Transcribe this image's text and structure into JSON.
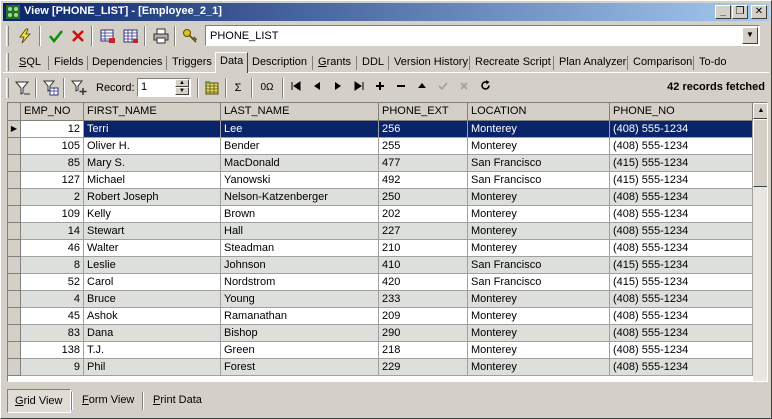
{
  "window": {
    "title": "View [PHONE_LIST] - [Employee_2_1]",
    "minimize_glyph": "_",
    "restore_glyph": "❐",
    "close_glyph": "✕"
  },
  "toolbar": {
    "object_combo_value": "PHONE_LIST",
    "icons": [
      "lightning-icon",
      "commit-check-icon",
      "rollback-x-icon",
      "grid-red-icon",
      "grid-table-icon",
      "printer-icon",
      "key-tools-icon"
    ]
  },
  "tabs": [
    {
      "label": "SQL",
      "accel": "S",
      "rest": "QL"
    },
    {
      "label": "Fields"
    },
    {
      "label": "Dependencies"
    },
    {
      "label": "Triggers"
    },
    {
      "label": "Data"
    },
    {
      "label": "Description"
    },
    {
      "label": "Grants",
      "accel": "G",
      "rest": "rants"
    },
    {
      "label": "DDL"
    },
    {
      "label": "Version History"
    },
    {
      "label": "Recreate Script"
    },
    {
      "label": "Plan Analyzer"
    },
    {
      "label": "Comparison"
    },
    {
      "label": "To-do"
    }
  ],
  "data_toolbar": {
    "record_label": "Record:",
    "record_value": "1",
    "sigma": "Σ",
    "omega": "0Ω",
    "status": "42 records fetched"
  },
  "grid": {
    "columns": [
      "EMP_NO",
      "FIRST_NAME",
      "LAST_NAME",
      "PHONE_EXT",
      "LOCATION",
      "PHONE_NO"
    ],
    "selected_row_indicator": "▶",
    "rows": [
      [
        "12",
        "Terri",
        "Lee",
        "256",
        "Monterey",
        "(408) 555-1234"
      ],
      [
        "105",
        "Oliver H.",
        "Bender",
        "255",
        "Monterey",
        "(408) 555-1234"
      ],
      [
        "85",
        "Mary S.",
        "MacDonald",
        "477",
        "San Francisco",
        "(415) 555-1234"
      ],
      [
        "127",
        "Michael",
        "Yanowski",
        "492",
        "San Francisco",
        "(415) 555-1234"
      ],
      [
        "2",
        "Robert Joseph",
        "Nelson-Katzenberger",
        "250",
        "Monterey",
        "(408) 555-1234"
      ],
      [
        "109",
        "Kelly",
        "Brown",
        "202",
        "Monterey",
        "(408) 555-1234"
      ],
      [
        "14",
        "Stewart",
        "Hall",
        "227",
        "Monterey",
        "(408) 555-1234"
      ],
      [
        "46",
        "Walter",
        "Steadman",
        "210",
        "Monterey",
        "(408) 555-1234"
      ],
      [
        "8",
        "Leslie",
        "Johnson",
        "410",
        "San Francisco",
        "(415) 555-1234"
      ],
      [
        "52",
        "Carol",
        "Nordstrom",
        "420",
        "San Francisco",
        "(415) 555-1234"
      ],
      [
        "4",
        "Bruce",
        "Young",
        "233",
        "Monterey",
        "(408) 555-1234"
      ],
      [
        "45",
        "Ashok",
        "Ramanathan",
        "209",
        "Monterey",
        "(408) 555-1234"
      ],
      [
        "83",
        "Dana",
        "Bishop",
        "290",
        "Monterey",
        "(408) 555-1234"
      ],
      [
        "138",
        "T.J.",
        "Green",
        "218",
        "Monterey",
        "(408) 555-1234"
      ],
      [
        "9",
        "Phil",
        "Forest",
        "229",
        "Monterey",
        "(408) 555-1234"
      ]
    ]
  },
  "view_tabs": [
    {
      "label": "Grid View",
      "accel": "G",
      "rest": "rid View"
    },
    {
      "label": "Form View",
      "accel": "F",
      "rest": "orm View"
    },
    {
      "label": "Print Data",
      "accel": "P",
      "rest": "rint Data"
    }
  ]
}
